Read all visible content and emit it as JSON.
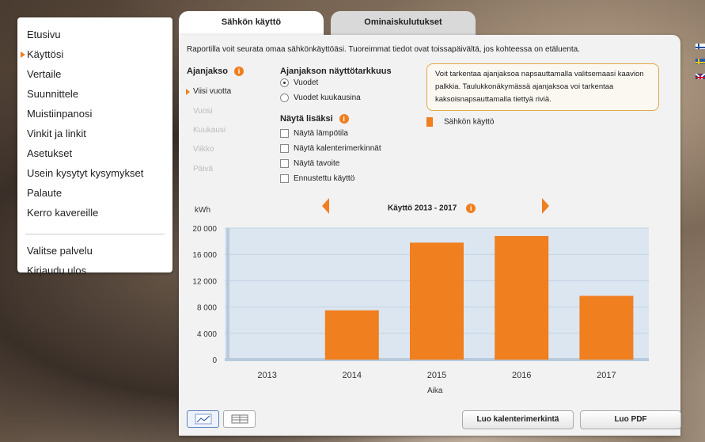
{
  "nav": {
    "items": [
      {
        "label": "Etusivu",
        "active": false
      },
      {
        "label": "Käyttösi",
        "active": true
      },
      {
        "label": "Vertaile",
        "active": false
      },
      {
        "label": "Suunnittele",
        "active": false
      },
      {
        "label": "Muistiinpanosi",
        "active": false
      },
      {
        "label": "Vinkit ja linkit",
        "active": false
      },
      {
        "label": "Asetukset",
        "active": false
      },
      {
        "label": "Usein kysytyt kysymykset",
        "active": false
      },
      {
        "label": "Palaute",
        "active": false
      },
      {
        "label": "Kerro kavereille",
        "active": false
      }
    ],
    "secondary": [
      {
        "label": "Valitse palvelu"
      },
      {
        "label": "Kirjaudu ulos"
      }
    ]
  },
  "tabs": [
    {
      "label": "Sähkön käyttö",
      "active": true
    },
    {
      "label": "Ominaiskulutukset",
      "active": false
    }
  ],
  "intro_text": "Raportilla voit seurata omaa sähkönkäyttöäsi. Tuoreimmat tiedot ovat toissapäivältä, jos kohteessa on etäluenta.",
  "period": {
    "title": "Ajanjakso",
    "items": [
      {
        "label": "Viisi vuotta",
        "active": true
      },
      {
        "label": "Vuosi",
        "active": false
      },
      {
        "label": "Kuukausi",
        "active": false
      },
      {
        "label": "Viikko",
        "active": false
      },
      {
        "label": "Päivä",
        "active": false
      }
    ]
  },
  "precision": {
    "title": "Ajanjakson näyttötarkkuus",
    "options": [
      {
        "label": "Vuodet",
        "checked": true
      },
      {
        "label": "Vuodet kuukausina",
        "checked": false
      }
    ]
  },
  "extras": {
    "title": "Näytä lisäksi",
    "options": [
      {
        "label": "Näytä lämpötila",
        "checked": false
      },
      {
        "label": "Näytä kalenterimerkinnät",
        "checked": false
      },
      {
        "label": "Näytä tavoite",
        "checked": false
      },
      {
        "label": "Ennustettu käyttö",
        "checked": false
      }
    ]
  },
  "hint": "Voit tarkentaa ajanjaksoa napsauttamalla valitsemaasi kaavion palkkia. Taulukkonäkymässä ajanjaksoa voi tarkentaa kaksoisnapsauttamalla tiettyä riviä.",
  "legend": {
    "label": "Sähkön käyttö",
    "color": "#f07f20"
  },
  "buttons": {
    "calendar": "Luo kalenterimerkintä",
    "pdf": "Luo PDF"
  },
  "icons": {
    "info": "info-icon",
    "prev": "arrow-left-icon",
    "next": "arrow-right-icon",
    "chart_view": "line-chart-icon",
    "table_view": "table-icon"
  },
  "chart_data": {
    "type": "bar",
    "title": "Käyttö 2013 - 2017",
    "ylabel": "kWh",
    "xlabel": "Aika",
    "categories": [
      "2013",
      "2014",
      "2015",
      "2016",
      "2017"
    ],
    "series": [
      {
        "name": "Sähkön käyttö",
        "values": [
          0,
          7500,
          17800,
          18800,
          9700
        ]
      }
    ],
    "yticks": [
      "20 000",
      "16 000",
      "12 000",
      "8 000",
      "4 000",
      "0"
    ],
    "ylim": [
      0,
      20000
    ],
    "bar_color": "#f07f20",
    "grid": true
  }
}
